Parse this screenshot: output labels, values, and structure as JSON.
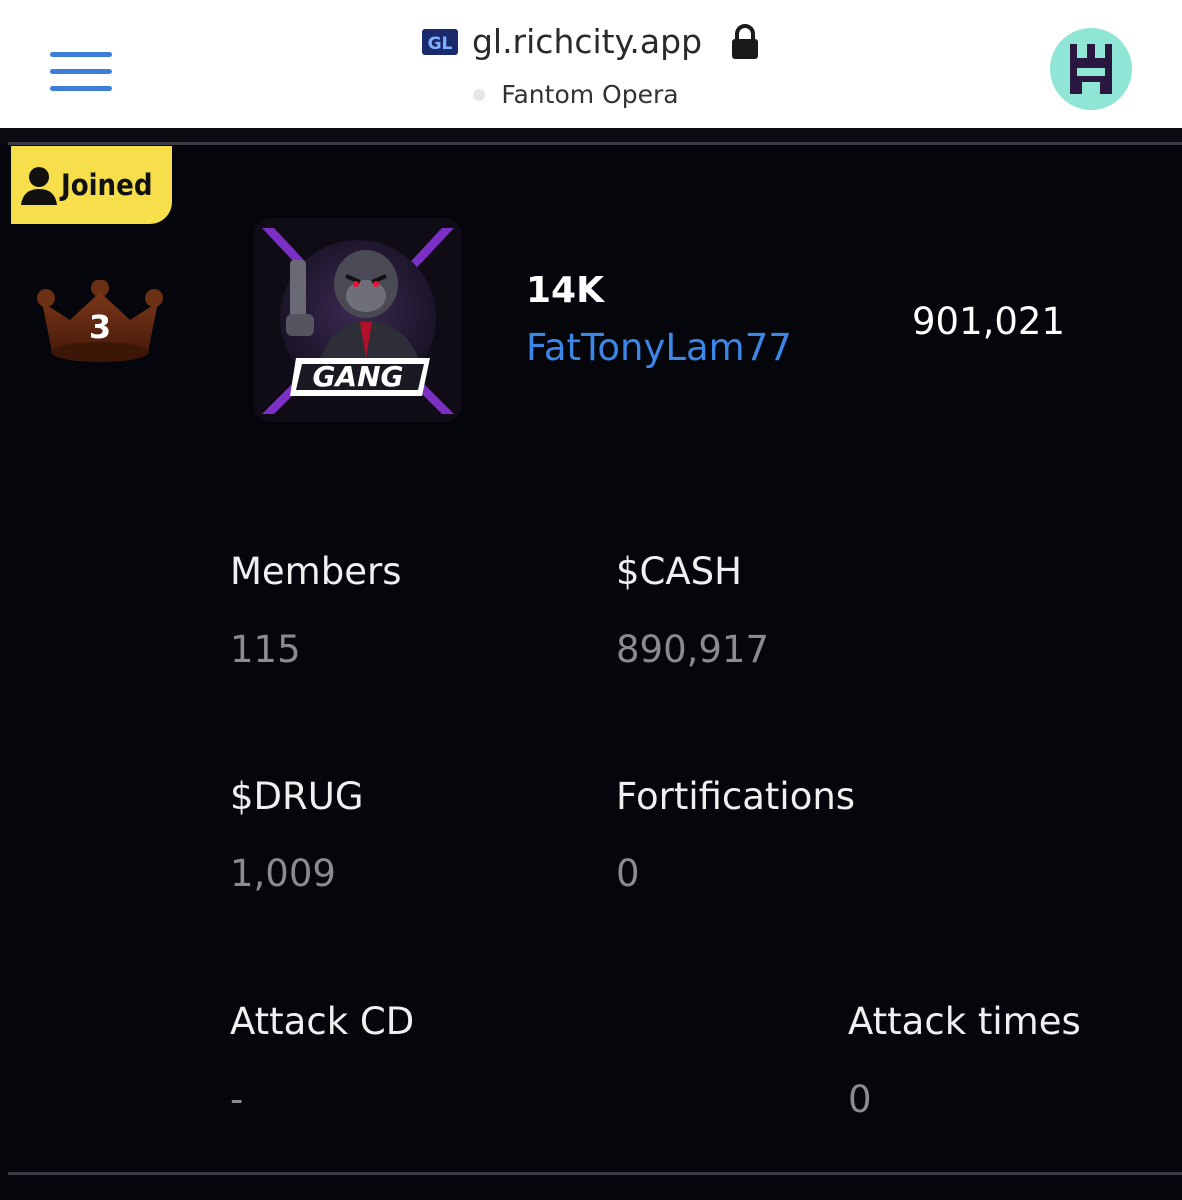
{
  "browser": {
    "favicon_text": "GL",
    "url": "gl.richcity.app",
    "network": "Fantom Opera",
    "lock_icon": "lock-icon",
    "menu_icon": "hamburger-icon",
    "avatar_icon": "wallet-avatar-icon"
  },
  "gang": {
    "joined_label": "Joined",
    "rank": "3",
    "logo_text": "GANG",
    "score": "14K",
    "leader": "FatTonyLam77",
    "power": "901,021"
  },
  "stats": {
    "members_label": "Members",
    "members_value": "115",
    "cash_label": "$CASH",
    "cash_value": "890,917",
    "drug_label": "$DRUG",
    "drug_value": "1,009",
    "fort_label": "Fortifications",
    "fort_value": "0",
    "attack_cd_label": "Attack CD",
    "attack_cd_value": "-",
    "attack_times_label": "Attack times",
    "attack_times_value": "0"
  },
  "colors": {
    "background": "#05050c",
    "accent_link": "#3c86e6",
    "joined_badge": "#f6df4a",
    "crown": "#6b2f14",
    "muted_value": "#8a8a90"
  }
}
